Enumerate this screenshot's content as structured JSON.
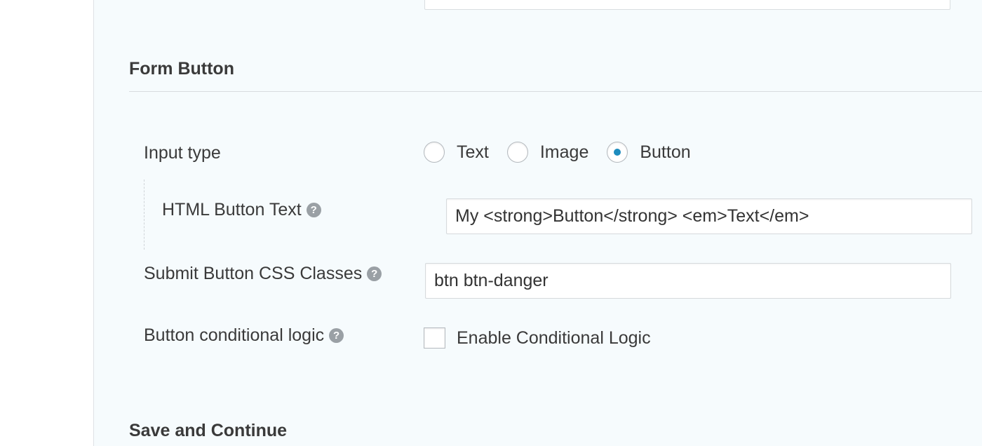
{
  "form_button": {
    "section_title": "Form Button",
    "input_type": {
      "label": "Input type",
      "options": [
        {
          "label": "Text",
          "selected": false
        },
        {
          "label": "Image",
          "selected": false
        },
        {
          "label": "Button",
          "selected": true
        }
      ]
    },
    "html_button_text": {
      "label": "HTML Button Text",
      "value": "My <strong>Button</strong> <em>Text</em>"
    },
    "submit_css_classes": {
      "label": "Submit Button CSS Classes",
      "value": "btn btn-danger"
    },
    "conditional_logic": {
      "label": "Button conditional logic",
      "checkbox_label": "Enable Conditional Logic",
      "checked": false
    },
    "help_icon_glyph": "?"
  },
  "save_continue": {
    "section_title": "Save and Continue"
  },
  "colors": {
    "panel_background": "#f6fbfd",
    "radio_selected": "#1e8cbe",
    "help_icon": "#9aa0a5"
  }
}
